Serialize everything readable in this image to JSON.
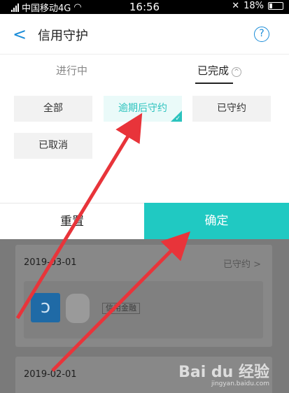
{
  "status_bar": {
    "carrier": "中国移动4G",
    "time": "16:56",
    "battery": "18%"
  },
  "nav": {
    "title": "信用守护",
    "help": "?"
  },
  "tabs": [
    {
      "label": "进行中",
      "active": false
    },
    {
      "label": "已完成",
      "active": true
    }
  ],
  "filters": [
    {
      "label": "全部",
      "selected": false
    },
    {
      "label": "逾期后守约",
      "selected": true
    },
    {
      "label": "已守约",
      "selected": false
    },
    {
      "label": "已取消",
      "selected": false
    }
  ],
  "actions": {
    "reset": "重置",
    "confirm": "确定"
  },
  "records": [
    {
      "date": "2019-03-01",
      "status": "已守约",
      "tag": "信用金融"
    },
    {
      "date": "2019-02-01"
    }
  ],
  "watermark": {
    "brand": "Bai du 经验",
    "url": "jingyan.baidu.com"
  },
  "colors": {
    "accent": "#20c9c2",
    "link": "#1a8cd8",
    "annotation": "#e8343a"
  }
}
